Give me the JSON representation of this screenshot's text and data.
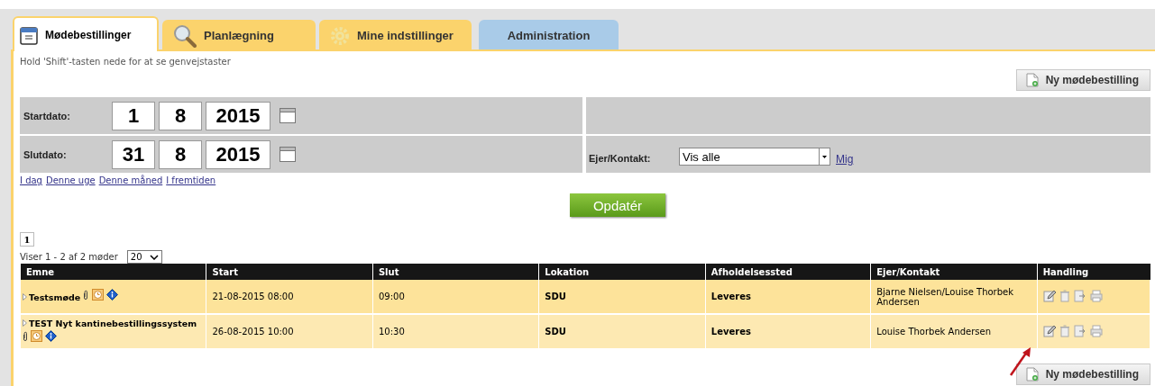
{
  "tabs": [
    {
      "label": "Mødebestillinger",
      "selected": true,
      "color": "#fbd36c"
    },
    {
      "label": "Planlægning",
      "selected": false,
      "color": "#fbd36c"
    },
    {
      "label": "Mine indstillinger",
      "selected": false,
      "color": "#fbd36c"
    },
    {
      "label": "Administration",
      "selected": false,
      "color": "#a9cbe8"
    }
  ],
  "hint": "Hold 'Shift'-tasten nede for at se genvejstaster",
  "new_button": "Ny mødebestilling",
  "filters": {
    "start_label": "Startdato:",
    "start": {
      "day": "1",
      "month": "8",
      "year": "2015"
    },
    "end_label": "Slutdato:",
    "end": {
      "day": "31",
      "month": "8",
      "year": "2015"
    },
    "owner_label": "Ejer/Kontakt:",
    "owner_value": "Vis alle",
    "me_link": "Mig"
  },
  "quick_links": [
    "I dag",
    "Denne uge",
    "Denne måned",
    "I fremtiden"
  ],
  "update_button": "Opdatér",
  "pages": [
    {
      "label": "1",
      "selected": true
    }
  ],
  "summary": "Viser 1 - 2 af 2 møder",
  "page_size": "20",
  "table": {
    "columns": [
      "Emne",
      "Start",
      "Slut",
      "Lokation",
      "Afholdelsessted",
      "Ejer/Kontakt",
      "Handling"
    ],
    "rows": [
      {
        "subject": "Testsmøde",
        "start": "21-08-2015 08:00",
        "end": "09:00",
        "location": "SDU",
        "venue": "Leveres",
        "owner": "Bjarne Nielsen/Louise Thorbek Andersen"
      },
      {
        "subject": "TEST Nyt kantinebestillingssystem",
        "start": "26-08-2015 10:00",
        "end": "10:30",
        "location": "SDU",
        "venue": "Leveres",
        "owner": "Louise Thorbek Andersen"
      }
    ]
  },
  "bottom_button": "Ny mødebestilling"
}
